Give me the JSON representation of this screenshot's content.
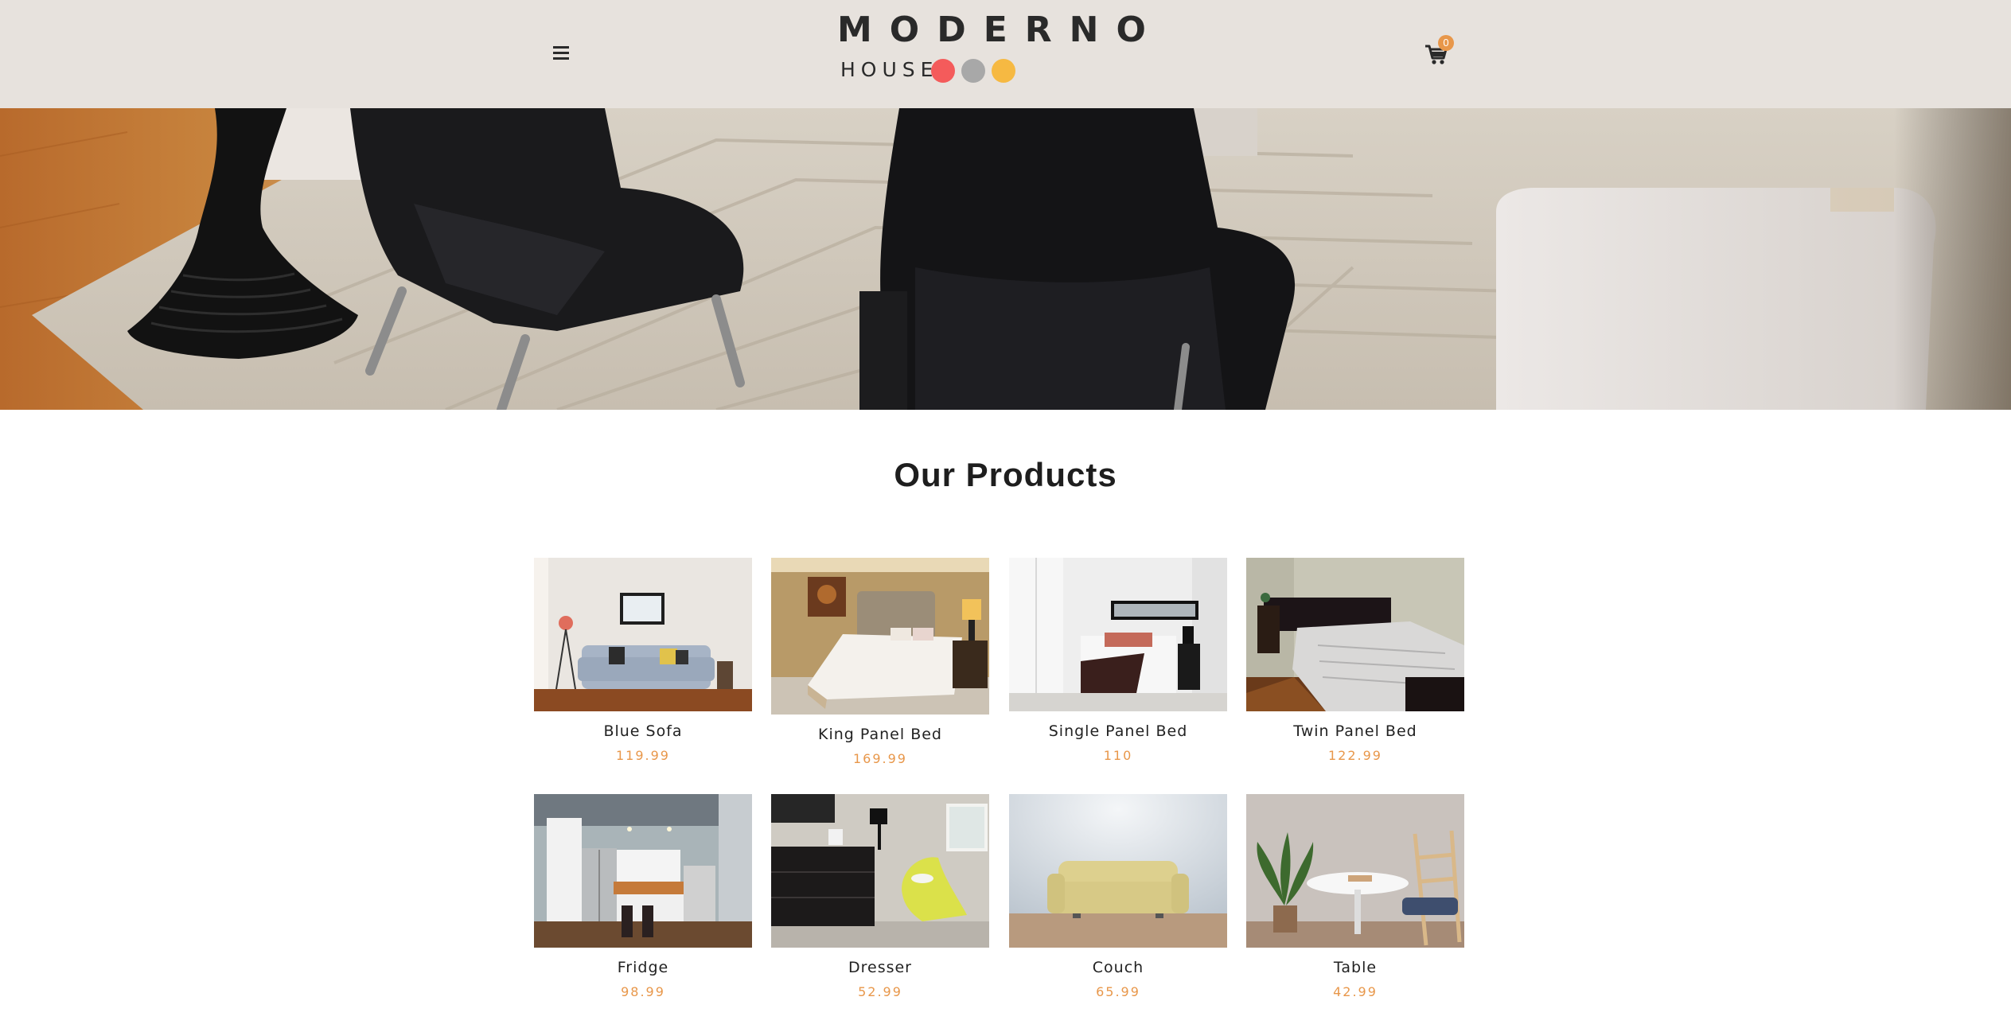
{
  "header": {
    "logo_main": "MODERNO",
    "logo_sub": "HOUSE",
    "logo_dot_colors": [
      "#f45b5b",
      "#a8a8a8",
      "#f6b942"
    ],
    "menu_icon": "hamburger-icon",
    "cart_icon": "shopping-cart-icon",
    "cart_count": "0",
    "accent_color": "#e8974a",
    "background_color": "#e7e2dd"
  },
  "hero": {
    "image": "living-room-black-armchairs-photo"
  },
  "products": {
    "title": "Our Products",
    "items": [
      {
        "name": "Blue Sofa",
        "price": "119.99",
        "image": "blue-sofa-photo"
      },
      {
        "name": "King Panel Bed",
        "price": "169.99",
        "image": "king-panel-bed-photo"
      },
      {
        "name": "Single Panel Bed",
        "price": "110",
        "image": "single-panel-bed-photo"
      },
      {
        "name": "Twin Panel Bed",
        "price": "122.99",
        "image": "twin-panel-bed-photo"
      },
      {
        "name": "Fridge",
        "price": "98.99",
        "image": "fridge-kitchen-photo"
      },
      {
        "name": "Dresser",
        "price": "52.99",
        "image": "dresser-photo"
      },
      {
        "name": "Couch",
        "price": "65.99",
        "image": "couch-photo"
      },
      {
        "name": "Table",
        "price": "42.99",
        "image": "table-chair-photo"
      }
    ]
  }
}
